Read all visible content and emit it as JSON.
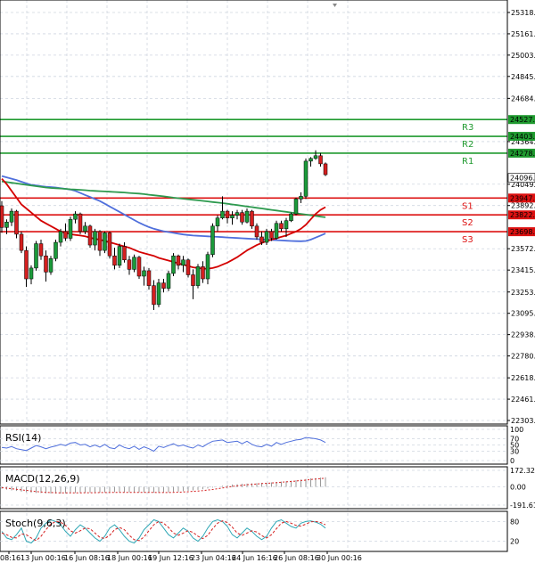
{
  "chart_data": {
    "type": "candlestick",
    "x_tick_labels": [
      "08:16",
      "13 Jun 00:16",
      "16 Jun 08:16",
      "18 Jun 00:16",
      "19 Jun 12:16",
      "23 Jun 04:16",
      "24 Jun 16:16",
      "26 Jun 08:16",
      "30 Jun 00:16"
    ],
    "y_tick_labels": [
      "25318.6",
      "25161.0",
      "25003.5",
      "24845.9",
      "24684.0",
      "24364.5",
      "24049.5",
      "23892.0",
      "23572.6",
      "23415.0",
      "23253.0",
      "23095.5",
      "22938.0",
      "22780.5",
      "22618.5",
      "22461.0",
      "22303.5"
    ],
    "price_ylim": [
      22303.5,
      25318.6
    ],
    "current_price": "24096.3",
    "colors": {
      "bull": "#1b9a3a",
      "bear": "#d41f1f",
      "ma_fast": "#d40000",
      "ma_mid": "#2e9a4f",
      "ma_slow": "#4f6fdc",
      "resistance": "#1f9a2f",
      "support": "#dd1111",
      "grid": "#cfd6e0"
    },
    "levels": [
      {
        "name": "R3",
        "value": 24527.3,
        "label": "24527.3",
        "kind": "resistance"
      },
      {
        "name": "R2",
        "value": 24403.2,
        "label": "24403.2",
        "kind": "resistance"
      },
      {
        "name": "R1",
        "value": 24278.8,
        "label": "24278.8",
        "kind": "resistance"
      },
      {
        "name": "S1",
        "value": 23947.2,
        "label": "23947.2",
        "kind": "support"
      },
      {
        "name": "S2",
        "value": 23822.8,
        "label": "23822.8",
        "kind": "support"
      },
      {
        "name": "S3",
        "value": 23698.5,
        "label": "23698.5",
        "kind": "support"
      }
    ],
    "candles": [
      [
        23890,
        23925,
        23690,
        23730
      ],
      [
        23730,
        23790,
        23680,
        23770
      ],
      [
        23770,
        23870,
        23740,
        23850
      ],
      [
        23850,
        23860,
        23650,
        23680
      ],
      [
        23680,
        23700,
        23540,
        23560
      ],
      [
        23560,
        23590,
        23290,
        23350
      ],
      [
        23350,
        23450,
        23310,
        23430
      ],
      [
        23430,
        23630,
        23410,
        23610
      ],
      [
        23610,
        23640,
        23490,
        23520
      ],
      [
        23520,
        23560,
        23330,
        23400
      ],
      [
        23400,
        23520,
        23380,
        23500
      ],
      [
        23500,
        23640,
        23480,
        23620
      ],
      [
        23620,
        23720,
        23590,
        23700
      ],
      [
        23700,
        23760,
        23630,
        23650
      ],
      [
        23650,
        23810,
        23630,
        23790
      ],
      [
        23790,
        23850,
        23760,
        23830
      ],
      [
        23830,
        23840,
        23680,
        23700
      ],
      [
        23700,
        23770,
        23680,
        23740
      ],
      [
        23740,
        23750,
        23580,
        23600
      ],
      [
        23600,
        23720,
        23560,
        23700
      ],
      [
        23700,
        23710,
        23520,
        23560
      ],
      [
        23560,
        23700,
        23540,
        23690
      ],
      [
        23690,
        23700,
        23500,
        23520
      ],
      [
        23520,
        23580,
        23420,
        23450
      ],
      [
        23450,
        23610,
        23430,
        23590
      ],
      [
        23590,
        23620,
        23470,
        23490
      ],
      [
        23490,
        23520,
        23380,
        23420
      ],
      [
        23420,
        23530,
        23400,
        23510
      ],
      [
        23510,
        23520,
        23350,
        23370
      ],
      [
        23370,
        23440,
        23300,
        23410
      ],
      [
        23410,
        23430,
        23270,
        23300
      ],
      [
        23300,
        23340,
        23120,
        23160
      ],
      [
        23160,
        23350,
        23140,
        23320
      ],
      [
        23320,
        23350,
        23250,
        23280
      ],
      [
        23280,
        23410,
        23260,
        23390
      ],
      [
        23390,
        23540,
        23370,
        23520
      ],
      [
        23520,
        23530,
        23420,
        23450
      ],
      [
        23450,
        23520,
        23400,
        23490
      ],
      [
        23490,
        23500,
        23360,
        23380
      ],
      [
        23380,
        23420,
        23200,
        23300
      ],
      [
        23300,
        23460,
        23280,
        23440
      ],
      [
        23440,
        23480,
        23320,
        23350
      ],
      [
        23350,
        23550,
        23310,
        23530
      ],
      [
        23530,
        23760,
        23510,
        23740
      ],
      [
        23740,
        23820,
        23700,
        23800
      ],
      [
        23800,
        23960,
        23790,
        23850
      ],
      [
        23850,
        23860,
        23760,
        23800
      ],
      [
        23800,
        23850,
        23750,
        23820
      ],
      [
        23820,
        23860,
        23790,
        23840
      ],
      [
        23840,
        23860,
        23750,
        23770
      ],
      [
        23770,
        23870,
        23760,
        23850
      ],
      [
        23850,
        23860,
        23720,
        23740
      ],
      [
        23740,
        23760,
        23640,
        23660
      ],
      [
        23660,
        23700,
        23600,
        23620
      ],
      [
        23620,
        23720,
        23600,
        23700
      ],
      [
        23700,
        23720,
        23630,
        23650
      ],
      [
        23650,
        23780,
        23640,
        23760
      ],
      [
        23760,
        23780,
        23700,
        23720
      ],
      [
        23720,
        23800,
        23660,
        23780
      ],
      [
        23780,
        23840,
        23770,
        23830
      ],
      [
        23830,
        23950,
        23820,
        23940
      ],
      [
        23940,
        23990,
        23910,
        23960
      ],
      [
        23960,
        24240,
        23940,
        24220
      ],
      [
        24220,
        24250,
        24180,
        24240
      ],
      [
        24240,
        24300,
        24230,
        24260
      ],
      [
        24260,
        24280,
        24180,
        24200
      ],
      [
        24200,
        24210,
        24110,
        24120
      ]
    ],
    "ma_fast": [
      24090,
      24050,
      24000,
      23950,
      23900,
      23870,
      23840,
      23810,
      23780,
      23760,
      23740,
      23720,
      23700,
      23690,
      23680,
      23675,
      23670,
      23665,
      23655,
      23645,
      23640,
      23630,
      23620,
      23610,
      23600,
      23590,
      23580,
      23565,
      23550,
      23540,
      23530,
      23520,
      23505,
      23495,
      23485,
      23475,
      23465,
      23455,
      23445,
      23435,
      23430,
      23425,
      23425,
      23430,
      23440,
      23455,
      23470,
      23490,
      23510,
      23535,
      23560,
      23580,
      23600,
      23615,
      23630,
      23640,
      23650,
      23660,
      23670,
      23685,
      23700,
      23720,
      23750,
      23790,
      23830,
      23860,
      23880
    ],
    "ma_mid": [
      24070,
      24065,
      24060,
      24055,
      24050,
      24045,
      24040,
      24035,
      24030,
      24025,
      24022,
      24020,
      24018,
      24015,
      24012,
      24010,
      24008,
      24005,
      24002,
      24000,
      23998,
      23996,
      23994,
      23992,
      23990,
      23988,
      23985,
      23982,
      23980,
      23976,
      23972,
      23968,
      23964,
      23960,
      23955,
      23950,
      23946,
      23942,
      23938,
      23934,
      23930,
      23926,
      23922,
      23918,
      23914,
      23910,
      23905,
      23900,
      23895,
      23890,
      23885,
      23880,
      23875,
      23870,
      23865,
      23860,
      23855,
      23850,
      23845,
      23840,
      23835,
      23830,
      23825,
      23820,
      23815,
      23810,
      23805
    ],
    "ma_slow": [
      24110,
      24100,
      24090,
      24080,
      24068,
      24055,
      24045,
      24040,
      24035,
      24030,
      24028,
      24025,
      24020,
      24015,
      24010,
      24000,
      23985,
      23970,
      23955,
      23940,
      23925,
      23905,
      23885,
      23865,
      23845,
      23825,
      23805,
      23785,
      23765,
      23748,
      23733,
      23720,
      23710,
      23702,
      23696,
      23690,
      23684,
      23678,
      23674,
      23670,
      23668,
      23666,
      23664,
      23662,
      23660,
      23658,
      23656,
      23654,
      23652,
      23650,
      23648,
      23646,
      23644,
      23642,
      23640,
      23638,
      23636,
      23634,
      23632,
      23630,
      23629,
      23628,
      23630,
      23640,
      23655,
      23670,
      23685
    ],
    "panels": [
      {
        "name": "RSI(14)",
        "ticks": [
          "100",
          "70",
          "50",
          "30",
          "0"
        ],
        "ylim": [
          0,
          100
        ],
        "tick_values": [
          100,
          70,
          50,
          30,
          0
        ]
      },
      {
        "name": "MACD(12,26,9)",
        "ticks": [
          "172.32",
          "0.00",
          "-191.61"
        ],
        "ylim": [
          -191.61,
          172.32
        ],
        "tick_values": [
          172.32,
          0,
          -191.61
        ]
      },
      {
        "name": "Stoch(9,6,3)",
        "ticks": [
          "80",
          "20"
        ],
        "ylim": [
          0,
          100
        ],
        "tick_values": [
          80,
          20
        ]
      }
    ],
    "rsi": [
      42,
      40,
      45,
      38,
      35,
      32,
      40,
      48,
      44,
      38,
      43,
      47,
      52,
      48,
      56,
      58,
      50,
      52,
      44,
      50,
      43,
      52,
      41,
      38,
      50,
      42,
      38,
      46,
      36,
      44,
      38,
      30,
      46,
      42,
      48,
      54,
      46,
      50,
      44,
      40,
      50,
      44,
      54,
      62,
      64,
      66,
      58,
      60,
      62,
      54,
      62,
      52,
      46,
      44,
      52,
      46,
      58,
      52,
      58,
      62,
      66,
      68,
      74,
      72,
      70,
      66,
      58
    ],
    "macd": [
      -20,
      -30,
      -38,
      -44,
      -50,
      -58,
      -62,
      -64,
      -66,
      -68,
      -70,
      -72,
      -70,
      -68,
      -66,
      -64,
      -62,
      -62,
      -60,
      -60,
      -60,
      -58,
      -58,
      -56,
      -56,
      -56,
      -56,
      -56,
      -58,
      -58,
      -60,
      -62,
      -62,
      -60,
      -58,
      -54,
      -50,
      -46,
      -42,
      -38,
      -32,
      -26,
      -18,
      -8,
      0,
      10,
      18,
      24,
      28,
      32,
      34,
      36,
      38,
      40,
      42,
      46,
      50,
      54,
      58,
      64,
      70,
      76,
      82,
      88,
      92,
      96,
      100
    ],
    "macd_signal": [
      -10,
      -14,
      -20,
      -26,
      -32,
      -38,
      -44,
      -50,
      -54,
      -58,
      -60,
      -62,
      -64,
      -64,
      -64,
      -64,
      -64,
      -62,
      -62,
      -62,
      -60,
      -60,
      -60,
      -58,
      -58,
      -58,
      -58,
      -58,
      -58,
      -58,
      -58,
      -58,
      -60,
      -60,
      -60,
      -58,
      -56,
      -54,
      -52,
      -48,
      -44,
      -40,
      -34,
      -28,
      -20,
      -12,
      -4,
      4,
      10,
      16,
      22,
      26,
      30,
      34,
      36,
      40,
      44,
      48,
      52,
      56,
      60,
      66,
      70,
      76,
      82,
      86,
      90
    ],
    "stoch_k": [
      50,
      30,
      25,
      40,
      60,
      20,
      15,
      30,
      60,
      75,
      85,
      80,
      70,
      50,
      35,
      55,
      70,
      60,
      45,
      30,
      20,
      35,
      60,
      70,
      55,
      35,
      20,
      15,
      30,
      55,
      70,
      85,
      80,
      60,
      40,
      30,
      45,
      60,
      50,
      30,
      20,
      35,
      60,
      80,
      85,
      80,
      65,
      40,
      30,
      45,
      60,
      50,
      35,
      25,
      35,
      60,
      80,
      85,
      75,
      65,
      60,
      75,
      80,
      82,
      78,
      72,
      60
    ],
    "stoch_d": [
      45,
      40,
      32,
      30,
      42,
      40,
      30,
      22,
      35,
      55,
      72,
      80,
      78,
      68,
      52,
      45,
      52,
      60,
      58,
      45,
      32,
      28,
      38,
      55,
      62,
      55,
      38,
      25,
      22,
      33,
      52,
      70,
      80,
      75,
      62,
      45,
      38,
      45,
      52,
      47,
      35,
      28,
      38,
      58,
      75,
      82,
      77,
      63,
      45,
      38,
      45,
      52,
      48,
      37,
      30,
      40,
      58,
      75,
      80,
      75,
      68,
      66,
      72,
      79,
      80,
      77,
      70
    ]
  }
}
